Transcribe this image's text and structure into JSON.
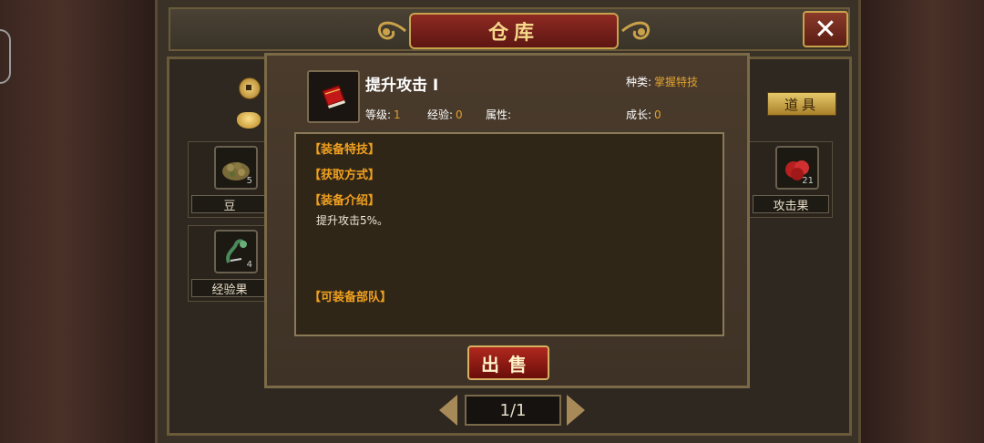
{
  "window": {
    "title": "仓库",
    "close_symbol": "✕"
  },
  "tabs": {
    "active_tab": "道具"
  },
  "currency": {
    "coin_icon": "coin-icon",
    "ingot_icon": "gold-ingot-icon"
  },
  "inventory": {
    "items": [
      {
        "label": "豆",
        "count": "5",
        "icon": "bean-sack-icon"
      },
      {
        "label": "经验果",
        "count": "4",
        "icon": "green-dragon-fruit-icon"
      },
      {
        "label": "攻击果",
        "count": "21",
        "icon": "red-fruit-icon"
      }
    ]
  },
  "pager": {
    "page": "1/1"
  },
  "detail": {
    "name": "提升攻击 Ⅰ",
    "icon": "red-book-icon",
    "kind_label": "种类:",
    "kind_value": "掌握特技",
    "level_label": "等级:",
    "level_value": "1",
    "exp_label": "经验:",
    "exp_value": "0",
    "attr_label": "属性:",
    "attr_value": "",
    "growth_label": "成长:",
    "growth_value": "0",
    "sections": {
      "skill": "【装备特技】",
      "obtain": "【获取方式】",
      "intro": "【装备介绍】",
      "intro_text": "提升攻击5%。",
      "troops": "【可装备部队】"
    },
    "sell_label": "出售"
  },
  "colors": {
    "accent": "#e0a030",
    "plaque": "#8e2a22",
    "gold": "#c9a24a"
  }
}
